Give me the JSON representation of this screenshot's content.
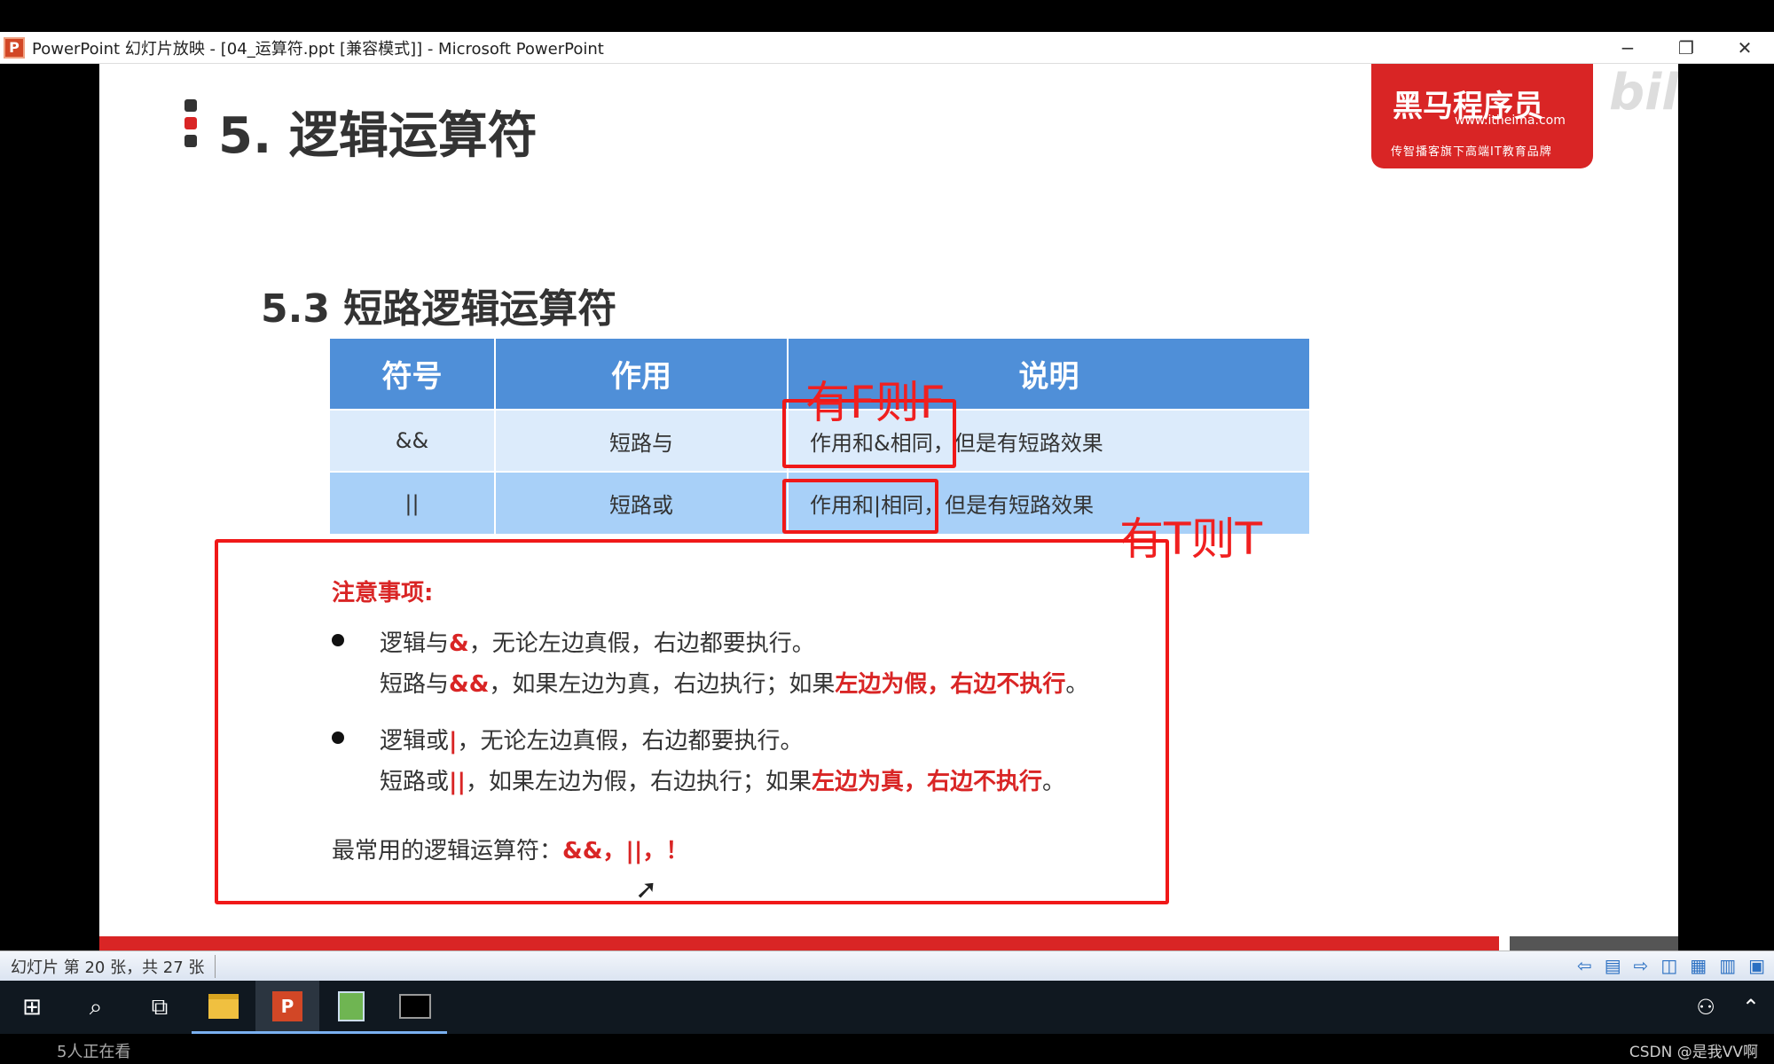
{
  "window": {
    "title": "PowerPoint 幻灯片放映 - [04_运算符.ppt [兼容模式]] - Microsoft PowerPoint",
    "app_icon": "P",
    "minimize": "−",
    "restore": "❐",
    "close": "✕"
  },
  "slide": {
    "title": "5. 逻辑运算符",
    "subtitle": "5.3 短路逻辑运算符",
    "logo": {
      "main": "黑马程序员",
      "url": "www.itheima.com",
      "sub": "传智播客旗下高端IT教育品牌"
    },
    "watermark_bili": "bilibili",
    "table": {
      "headers": [
        "符号",
        "作用",
        "说明"
      ],
      "rows": [
        {
          "symbol": "&&",
          "function": "短路与",
          "desc_boxed": "作用和&相同，",
          "desc_rest": "但是有短路效果"
        },
        {
          "symbol": "||",
          "function": "短路或",
          "desc_boxed": "作用和|相同，",
          "desc_rest": "但是有短路效果"
        }
      ]
    },
    "annotations": {
      "and_note": "有F则F",
      "or_note": "有T则T"
    },
    "notes": {
      "heading": "注意事项:",
      "item1": {
        "line1_a": "逻辑与",
        "line1_op": "&",
        "line1_b": "，无论左边真假，右边都要执行。",
        "line2_a": "短路与",
        "line2_op": "&&",
        "line2_b": "，如果左边为真，右边执行；如果",
        "line2_hl": "左边为假，右边不执行",
        "line2_end": "。"
      },
      "item2": {
        "line1_a": "逻辑或",
        "line1_op": "|",
        "line1_b": "，无论左边真假，右边都要执行。",
        "line2_a": "短路或",
        "line2_op": "||",
        "line2_b": "，如果左边为假，右边执行；如果",
        "line2_hl": "左边为真，右边不执行",
        "line2_end": "。"
      },
      "common_label": "最常用的逻辑运算符：",
      "common_ops": "&&，||，！"
    }
  },
  "statusbar": {
    "slide_info": "幻灯片 第 20 张，共 27 张"
  },
  "taskbar": {
    "start": "⊞",
    "search": "⌕",
    "taskview": "⧉"
  },
  "bottom": {
    "viewers": "5人正在看",
    "watermark": "CSDN @是我VV啊"
  },
  "colors": {
    "accent_red": "#d92525",
    "table_header": "#4f8fd8",
    "row1": "#dcebfb",
    "row2": "#a8d0f8",
    "annotation_red": "#f01818"
  }
}
